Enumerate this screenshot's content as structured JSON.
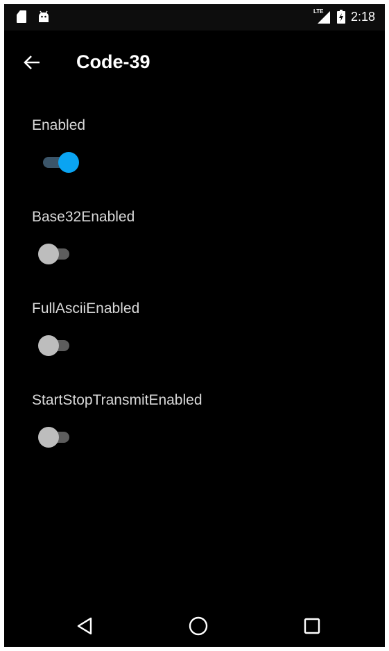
{
  "status_bar": {
    "time": "2:18",
    "network_label": "LTE",
    "icons": [
      "sd-card-icon",
      "android-icon",
      "lte-signal-icon",
      "battery-charging-icon"
    ]
  },
  "app_bar": {
    "title": "Code-39",
    "back_icon": "arrow-left-icon"
  },
  "settings": [
    {
      "label": "Enabled",
      "checked": true
    },
    {
      "label": "Base32Enabled",
      "checked": false
    },
    {
      "label": "FullAsciiEnabled",
      "checked": false
    },
    {
      "label": "StartStopTransmitEnabled",
      "checked": false
    }
  ],
  "nav_bar": {
    "icons": [
      "triangle-back-icon",
      "circle-home-icon",
      "square-recents-icon"
    ]
  },
  "colors": {
    "background": "#000000",
    "accent": "#0aa4f2",
    "accent_track": "#3b5569",
    "label": "#d9d9d9",
    "switch_off_thumb": "#bdbdbd",
    "switch_off_track": "#5d5d5d"
  }
}
